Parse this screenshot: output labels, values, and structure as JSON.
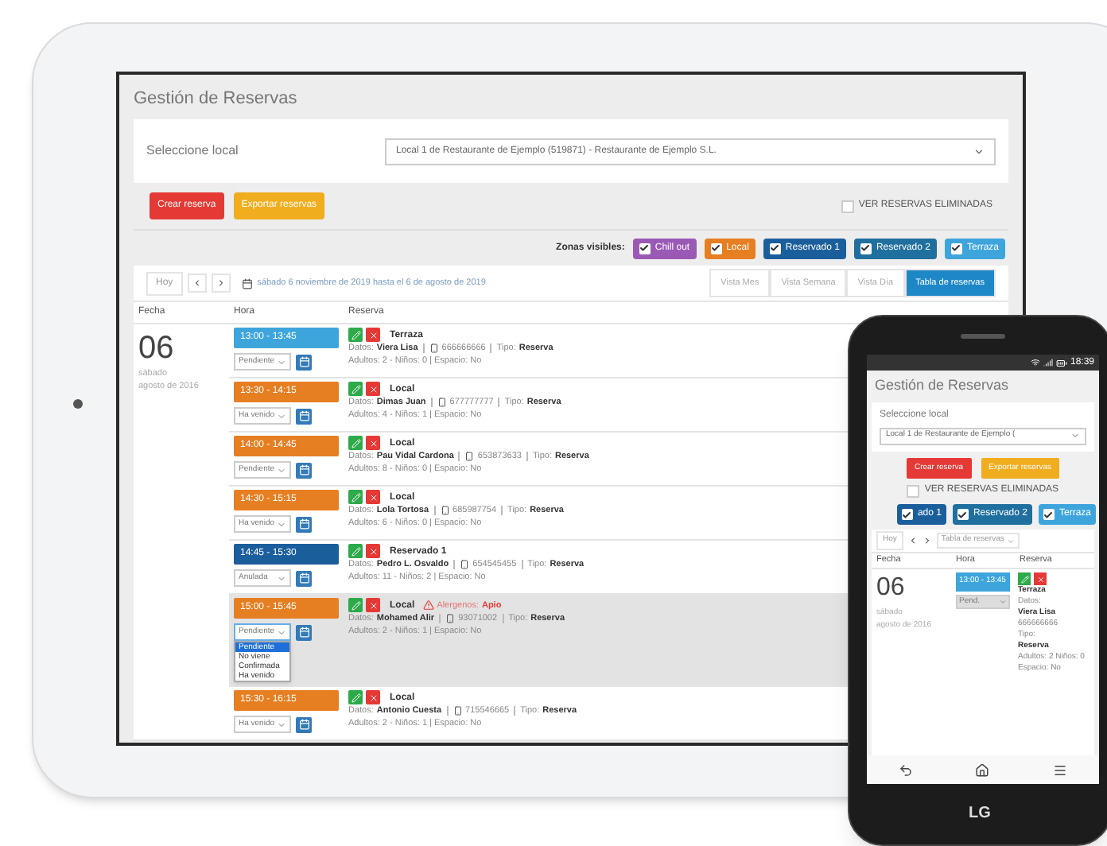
{
  "tablet": {
    "title": "Gestión de Reservas",
    "local_label": "Seleccione local",
    "local_select": "Local 1 de Restaurante de Ejemplo (519871) - Restaurante de Ejemplo S.L.",
    "actions": [
      {
        "label": "Crear reserva",
        "kind": "create"
      },
      {
        "label": "Exportar reservas",
        "kind": "export"
      }
    ],
    "deleted_toggle": {
      "label": "VER RESERVAS ELIMINADAS",
      "checked": false
    },
    "zones_label": "Zonas visibles:",
    "zones": [
      {
        "label": "Chill out",
        "color": "#9b59b6",
        "checked": true
      },
      {
        "label": "Local",
        "color": "#e67e22",
        "checked": true
      },
      {
        "label": "Reservado 1",
        "color": "#1b5e9c",
        "checked": true
      },
      {
        "label": "Reservado 2",
        "color": "#1f6f9f",
        "checked": true
      },
      {
        "label": "Terraza",
        "color": "#3da5dc",
        "checked": true
      }
    ],
    "today": "Hoy",
    "range": "sábado 6 noviembre de 2019 hasta el 6 de agosto de 2019",
    "views": [
      {
        "label": "Vista Mes",
        "selected": false
      },
      {
        "label": "Vista Semana",
        "selected": false
      },
      {
        "label": "Vista Día",
        "selected": false
      },
      {
        "label": "Tabla de reservas",
        "selected": true
      }
    ],
    "columns": [
      "Fecha",
      "Hora",
      "Reserva"
    ],
    "day": "06",
    "weekday": "sábado",
    "month": "agosto de 2016",
    "rows": [
      {
        "time": "13:00 - 13:45",
        "color": "#3da5dc",
        "status": "Pendiente",
        "zone": "Terraza",
        "client_label": "Datos:",
        "client": "Viera Lisa",
        "phone": "666666666",
        "type_label": "Tipo:",
        "type": "Reserva",
        "details": "Adultos: 2 - Niños: 0 | Espacio: No",
        "highlighted": false,
        "expanded": false
      },
      {
        "time": "13:30 - 14:15",
        "color": "#e67e22",
        "status": "Ha venido",
        "zone": "Local",
        "client_label": "Datos:",
        "client": "Dimas Juan",
        "phone": "677777777",
        "type_label": "Tipo:",
        "type": "Reserva",
        "details": "Adultos: 4 - Niños: 1 | Espacio: No",
        "highlighted": false,
        "expanded": false
      },
      {
        "time": "14:00 - 14:45",
        "color": "#e67e22",
        "status": "Pendiente",
        "zone": "Local",
        "client_label": "Datos:",
        "client": "Pau Vidal Cardona",
        "phone": "653873633",
        "type_label": "Tipo:",
        "type": "Reserva",
        "details": "Adultos: 8 - Niños: 0 | Espacio: No",
        "highlighted": false,
        "expanded": false
      },
      {
        "time": "14:30 - 15:15",
        "color": "#e67e22",
        "status": "Ha venido",
        "zone": "Local",
        "client_label": "Datos:",
        "client": "Lola Tortosa",
        "phone": "685987754",
        "type_label": "Tipo:",
        "type": "Reserva",
        "details": "Adultos: 6 - Niños: 0 | Espacio: No",
        "highlighted": false,
        "expanded": false
      },
      {
        "time": "14:45 - 15:30",
        "color": "#1b5e9c",
        "status": "Anulada",
        "zone": "Reservado 1",
        "client_label": "Datos:",
        "client": "Pedro L. Osvaldo",
        "phone": "654545455",
        "type_label": "Tipo:",
        "type": "Reserva",
        "details": "Adultos: 11 - Niños: 2 | Espacio: No",
        "highlighted": false,
        "expanded": false
      },
      {
        "time": "15:00 - 15:45",
        "color": "#e67e22",
        "status": "Pendiente",
        "zone": "Local",
        "alert": "Alergenos:",
        "alert_value": "Apio",
        "client_label": "Datos:",
        "client": "Mohamed Alir",
        "phone": "93071002",
        "type_label": "Tipo:",
        "type": "Reserva",
        "details": "Adultos: 2 - Niños: 1 | Espacio: No",
        "highlighted": true,
        "expanded": true,
        "options": [
          {
            "label": "Pendiente",
            "selected": true
          },
          {
            "label": "No viene",
            "selected": false
          },
          {
            "label": "Confirmada",
            "selected": false
          },
          {
            "label": "Ha venido",
            "selected": false
          }
        ]
      },
      {
        "time": "15:30 - 16:15",
        "color": "#e67e22",
        "status": "Ha venido",
        "zone": "Local",
        "client_label": "Datos:",
        "client": "Antonio Cuesta",
        "phone": "715546665",
        "type_label": "Tipo:",
        "type": "Reserva",
        "details": "Adultos: 2 - Niños: 1 | Espacio: No",
        "highlighted": false,
        "expanded": false
      }
    ]
  },
  "phone": {
    "clock": "18:39",
    "title": "Gestión de Reservas",
    "local_label": "Seleccione local",
    "local_select": "Local 1 de Restaurante de Ejemplo (",
    "actions": [
      {
        "label": "Crear reserva",
        "kind": "create"
      },
      {
        "label": "Exportar reservas",
        "kind": "export"
      }
    ],
    "deleted_toggle": {
      "label": "VER RESERVAS ELIMINADAS",
      "checked": false
    },
    "zones": [
      {
        "label": "ado 1",
        "color": "#1b5e9c",
        "checked": true
      },
      {
        "label": "Reservado 2",
        "color": "#1f6f9f",
        "checked": true
      },
      {
        "label": "Terraza",
        "color": "#3da5dc",
        "checked": true
      }
    ],
    "today": "Hoy",
    "view_select": "Tabla de reservas",
    "columns": [
      "Fecha",
      "Hora",
      "Reserva"
    ],
    "day": "06",
    "weekday": "sábado",
    "month": "agosto de 2016",
    "row": {
      "time": "13:00 - 13:45",
      "color": "#3da5dc",
      "status": "Pend.",
      "zone": "Terraza",
      "client_label": "Datos:",
      "client": "Viera Lisa",
      "phone": "666666666",
      "type_label": "Tipo:",
      "type": "Reserva",
      "details": "Adultos: 2 Niños: 0 Espacio: No"
    },
    "brand": "LG"
  }
}
